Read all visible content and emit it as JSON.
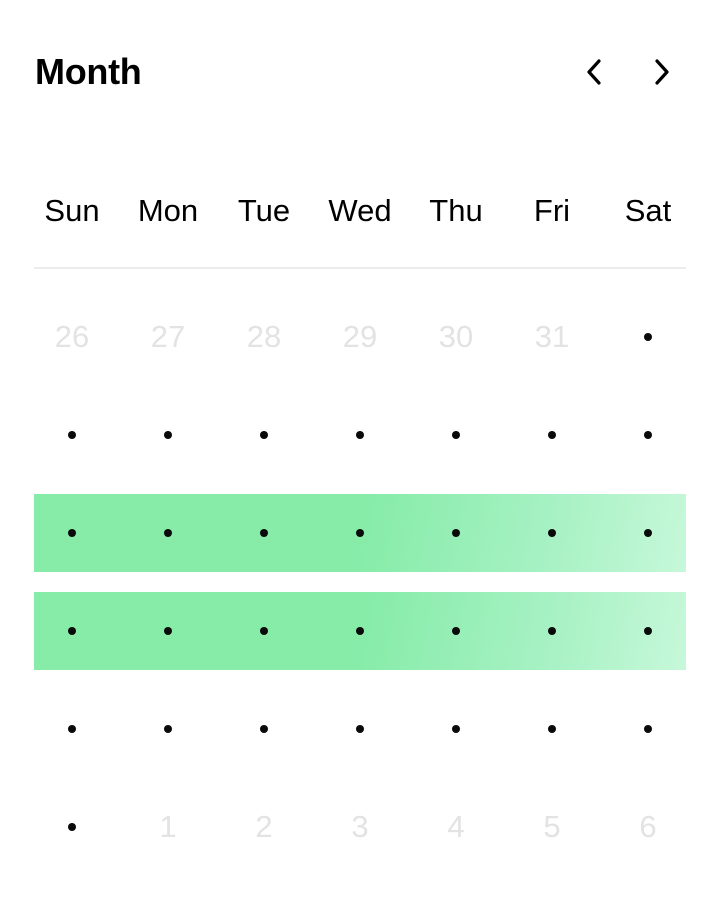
{
  "header": {
    "title": "Month",
    "prev_icon": "chevron-left-icon",
    "next_icon": "chevron-right-icon"
  },
  "weekdays": [
    "Sun",
    "Mon",
    "Tue",
    "Wed",
    "Thu",
    "Fri",
    "Sat"
  ],
  "weeks": [
    {
      "highlighted": false,
      "days": [
        {
          "label": "26",
          "outside_month": true
        },
        {
          "label": "27",
          "outside_month": true
        },
        {
          "label": "28",
          "outside_month": true
        },
        {
          "label": "29",
          "outside_month": true
        },
        {
          "label": "30",
          "outside_month": true
        },
        {
          "label": "31",
          "outside_month": true
        },
        {
          "label": "",
          "outside_month": false
        }
      ]
    },
    {
      "highlighted": false,
      "days": [
        {
          "label": "",
          "outside_month": false
        },
        {
          "label": "",
          "outside_month": false
        },
        {
          "label": "",
          "outside_month": false
        },
        {
          "label": "",
          "outside_month": false
        },
        {
          "label": "",
          "outside_month": false
        },
        {
          "label": "",
          "outside_month": false
        },
        {
          "label": "",
          "outside_month": false
        }
      ]
    },
    {
      "highlighted": true,
      "days": [
        {
          "label": "",
          "outside_month": false
        },
        {
          "label": "",
          "outside_month": false
        },
        {
          "label": "",
          "outside_month": false
        },
        {
          "label": "",
          "outside_month": false
        },
        {
          "label": "",
          "outside_month": false
        },
        {
          "label": "",
          "outside_month": false
        },
        {
          "label": "",
          "outside_month": false
        }
      ]
    },
    {
      "highlighted": true,
      "days": [
        {
          "label": "",
          "outside_month": false
        },
        {
          "label": "",
          "outside_month": false
        },
        {
          "label": "",
          "outside_month": false
        },
        {
          "label": "",
          "outside_month": false
        },
        {
          "label": "",
          "outside_month": false
        },
        {
          "label": "",
          "outside_month": false
        },
        {
          "label": "",
          "outside_month": false
        }
      ]
    },
    {
      "highlighted": false,
      "days": [
        {
          "label": "",
          "outside_month": false
        },
        {
          "label": "",
          "outside_month": false
        },
        {
          "label": "",
          "outside_month": false
        },
        {
          "label": "",
          "outside_month": false
        },
        {
          "label": "",
          "outside_month": false
        },
        {
          "label": "",
          "outside_month": false
        },
        {
          "label": "",
          "outside_month": false
        }
      ]
    },
    {
      "highlighted": false,
      "days": [
        {
          "label": "",
          "outside_month": false
        },
        {
          "label": "1",
          "outside_month": true
        },
        {
          "label": "2",
          "outside_month": true
        },
        {
          "label": "3",
          "outside_month": true
        },
        {
          "label": "4",
          "outside_month": true
        },
        {
          "label": "5",
          "outside_month": true
        },
        {
          "label": "6",
          "outside_month": true
        }
      ]
    }
  ],
  "colors": {
    "highlight_start": "#86eca8",
    "highlight_end": "#c6f8d9",
    "muted_text": "#e3e3e3",
    "divider": "#ececec",
    "dot": "#0a0a0a"
  }
}
